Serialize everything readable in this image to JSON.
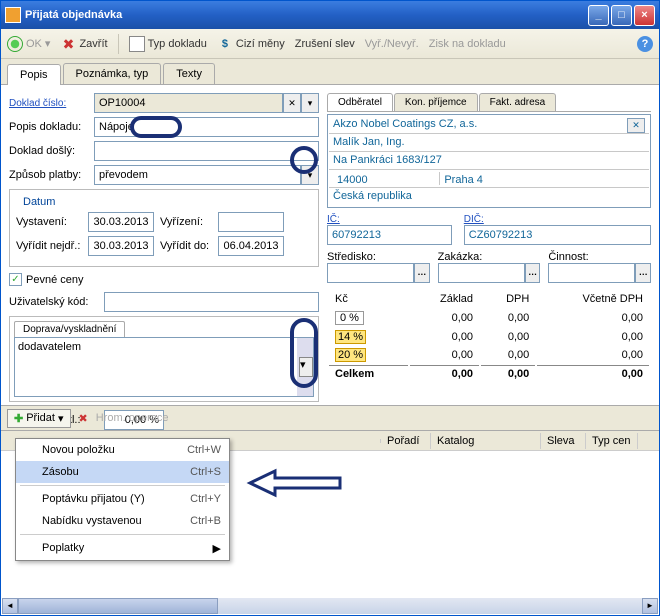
{
  "window": {
    "title": "Přijatá objednávka"
  },
  "toolbar": {
    "ok": "OK",
    "zavrit": "Zavřít",
    "typ": "Typ dokladu",
    "meny": "Cizí měny",
    "slevy": "Zrušení slev",
    "vyr": "Vyř./Nevyř.",
    "zisk": "Zisk na dokladu"
  },
  "tabs": {
    "popis": "Popis",
    "poznamka": "Poznámka, typ",
    "texty": "Texty"
  },
  "left": {
    "doklad_cislo_lbl": "Doklad číslo:",
    "doklad_cislo": "OP10004",
    "popis_lbl": "Popis dokladu:",
    "popis": "Nápoje",
    "dosly_lbl": "Doklad došlý:",
    "dosly": "",
    "platba_lbl": "Způsob platby:",
    "platba": "převodem",
    "datum_legend": "Datum",
    "vystaveni_lbl": "Vystavení:",
    "vystaveni": "30.03.2013",
    "vyrizeni_lbl": "Vyřízení:",
    "vyrizeni": "",
    "nejdr_lbl": "Vyřídit nejdř.:",
    "nejdr": "30.03.2013",
    "do_lbl": "Vyřídit do:",
    "do": "06.04.2013",
    "pevne_ceny": "Pevné ceny",
    "uziv_lbl": "Uživatelský kód:",
    "uziv": "",
    "doprava_tab": "Doprava/vyskladnění",
    "doprava": "dodavatelem",
    "sleva_lbl": "Sleva za dokl.:",
    "sleva": "0,00 %"
  },
  "right": {
    "tab_odb": "Odběratel",
    "tab_kon": "Kon. příjemce",
    "tab_fakt": "Fakt. adresa",
    "addr1": "Akzo Nobel Coatings CZ, a.s.",
    "addr2": "Malík Jan, Ing.",
    "addr3": "Na Pankráci 1683/127",
    "addr_zip": "14000",
    "addr_city": "Praha 4",
    "addr5": "Česká republika",
    "ic_lbl": "IČ:",
    "ic": "60792213",
    "dic_lbl": "DIČ:",
    "dic": "CZ60792213",
    "stredisko_lbl": "Středisko:",
    "zakazka_lbl": "Zakázka:",
    "cinnost_lbl": "Činnost:",
    "sum": {
      "h_kc": "Kč",
      "h_zaklad": "Základ",
      "h_dph": "DPH",
      "h_vc": "Včetně DPH",
      "r0": "0 %",
      "r14": "14 %",
      "r20": "20 %",
      "celkem": "Celkem",
      "z": "0,00"
    }
  },
  "items": {
    "pridat": "Přidat",
    "hrom": "Hrom. operace",
    "h_poradi": "Pořadí",
    "h_katalog": "Katalog",
    "h_sleva": "Sleva",
    "h_typ": "Typ cen"
  },
  "menu": {
    "novou": "Novou položku",
    "novou_k": "Ctrl+W",
    "zasobu": "Zásobu",
    "zasobu_k": "Ctrl+S",
    "popt": "Poptávku přijatou (Y)",
    "popt_k": "Ctrl+Y",
    "nab": "Nabídku vystavenou",
    "nab_k": "Ctrl+B",
    "popl": "Poplatky"
  }
}
